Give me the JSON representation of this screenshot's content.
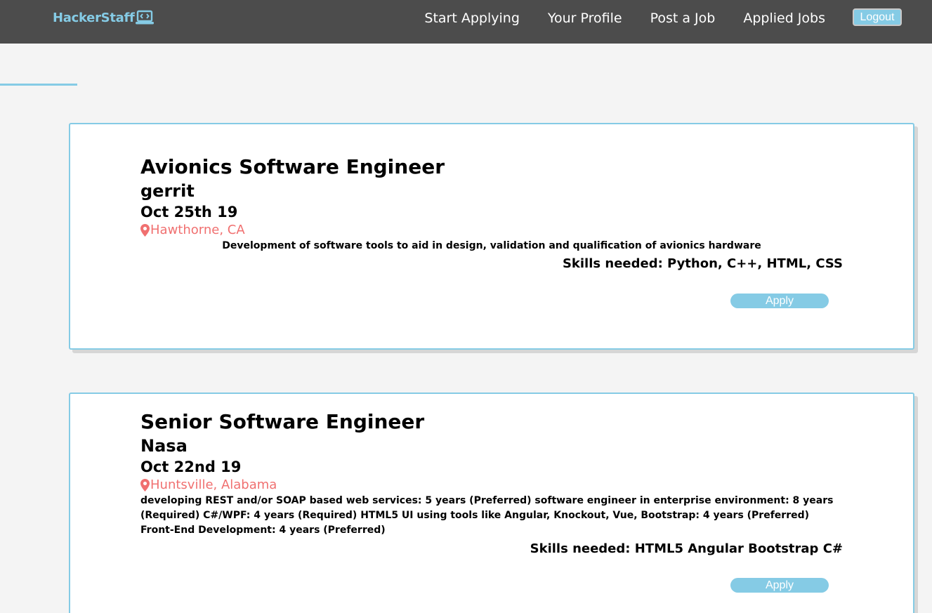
{
  "brand": {
    "name": "HackerStaff",
    "icon": "laptop-code-icon",
    "color": "#85cbe5"
  },
  "nav": {
    "links": [
      "Start Applying",
      "Your Profile",
      "Post a Job",
      "Applied Jobs"
    ],
    "logout_label": "Logout"
  },
  "colors": {
    "accent": "#85cbe5",
    "location": "#f07070",
    "navbar": "#4c4c4c"
  },
  "jobs": [
    {
      "title": "Avionics Software Engineer",
      "company": "gerrit",
      "date": "Oct 25th 19",
      "location": "Hawthorne, CA",
      "description": "Development of software tools to aid in design, validation and qualification of avionics hardware",
      "skills": "Skills needed: Python, C++, HTML, CSS",
      "apply_label": "Apply"
    },
    {
      "title": "Senior Software Engineer",
      "company": "Nasa",
      "date": "Oct 22nd 19",
      "location": "Huntsville, Alabama",
      "description": "developing REST and/or SOAP based web services: 5 years (Preferred) software engineer in enterprise environment: 8 years (Required) C#/WPF: 4 years (Required) HTML5 UI using tools like Angular, Knockout, Vue, Bootstrap: 4 years (Preferred) Front-End Development: 4 years (Preferred)",
      "skills": "Skills needed: HTML5 Angular Bootstrap C#",
      "apply_label": "Apply"
    }
  ]
}
